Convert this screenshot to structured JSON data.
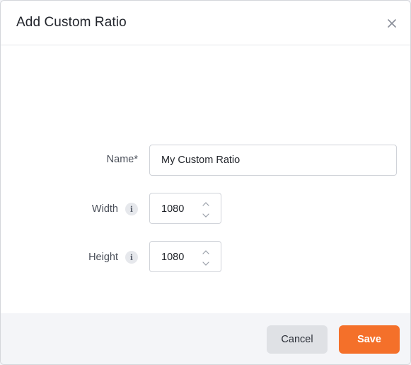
{
  "dialog": {
    "title": "Add Custom Ratio",
    "close_icon": "close-icon"
  },
  "form": {
    "name": {
      "label": "Name*",
      "value": "My Custom Ratio"
    },
    "width": {
      "label": "Width",
      "info_icon": "info-icon",
      "info_glyph": "i",
      "value": "1080"
    },
    "height": {
      "label": "Height",
      "info_icon": "info-icon",
      "info_glyph": "i",
      "value": "1080"
    }
  },
  "footer": {
    "cancel_label": "Cancel",
    "save_label": "Save"
  },
  "colors": {
    "accent": "#f4702a",
    "cancel_bg": "#dfe1e5",
    "footer_bg": "#f4f5f8"
  }
}
